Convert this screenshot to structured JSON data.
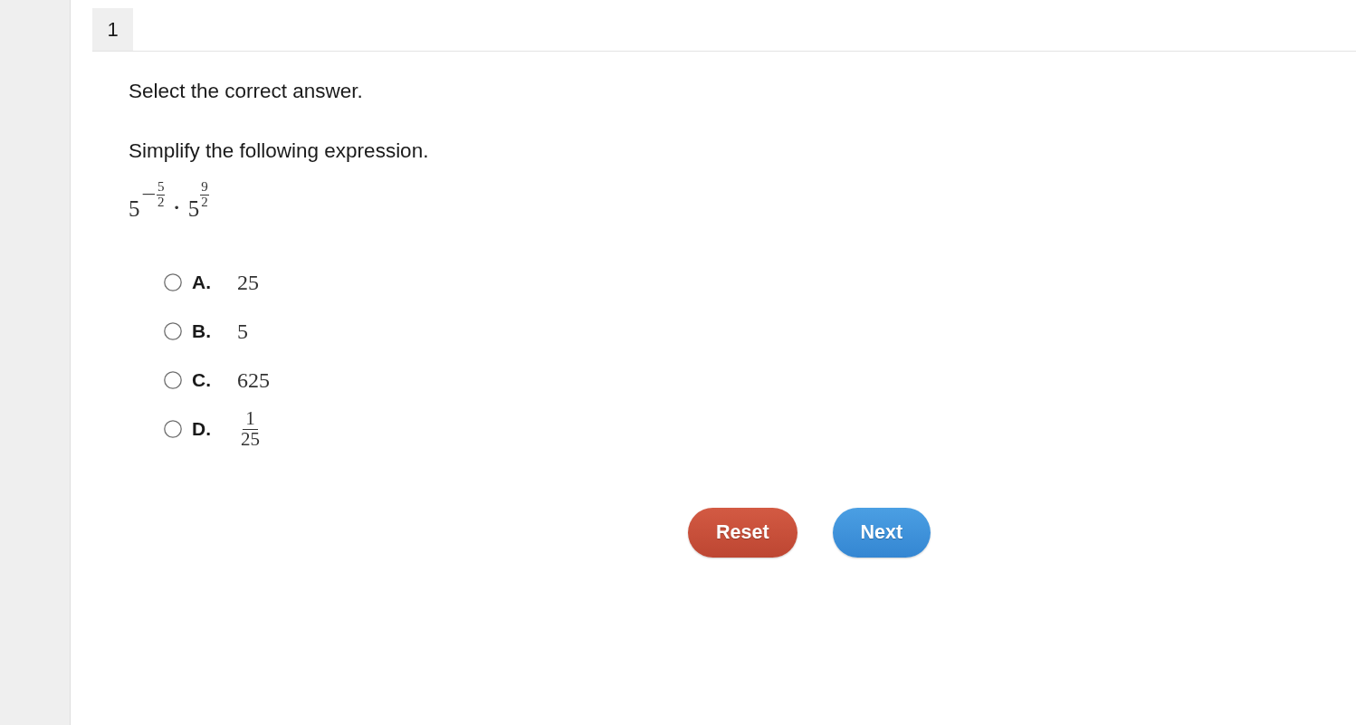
{
  "question_tab": {
    "label": "1"
  },
  "instruction": "Select the correct answer.",
  "prompt": "Simplify the following expression.",
  "expression": {
    "terms": [
      {
        "base": "5",
        "exponent": {
          "sign": "−",
          "numerator": "5",
          "denominator": "2"
        }
      },
      {
        "base": "5",
        "exponent": {
          "numerator": "9",
          "denominator": "2"
        }
      }
    ],
    "operator": "·"
  },
  "options": [
    {
      "letter": "A.",
      "kind": "number",
      "value": "25",
      "selected": false
    },
    {
      "letter": "B.",
      "kind": "number",
      "value": "5",
      "selected": false
    },
    {
      "letter": "C.",
      "kind": "number",
      "value": "625",
      "selected": false
    },
    {
      "letter": "D.",
      "kind": "fraction",
      "numerator": "1",
      "denominator": "25",
      "selected": false
    }
  ],
  "buttons": [
    {
      "label": "Reset",
      "kind": "reset"
    },
    {
      "label": "Next",
      "kind": "next"
    }
  ]
}
